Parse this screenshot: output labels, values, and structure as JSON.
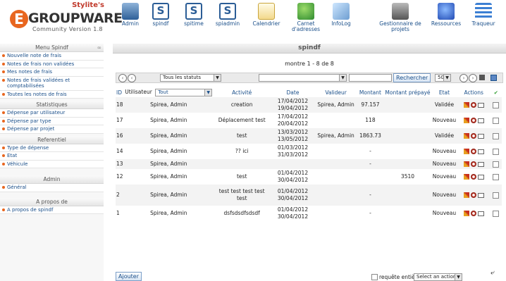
{
  "logo": {
    "brand": "Stylite's",
    "letter": "E",
    "name": "GROUPWARE",
    "version": "Community Version 1.8"
  },
  "apps": [
    {
      "label": "Admin",
      "icon": "admin-icon"
    },
    {
      "label": "spindf",
      "icon": "spindf-icon"
    },
    {
      "label": "spitime",
      "icon": "spitime-icon"
    },
    {
      "label": "spiadmin",
      "icon": "spiadmin-icon"
    },
    {
      "label": "Calendrier",
      "icon": "calendar-icon"
    },
    {
      "label": "Carnet d'adresses",
      "icon": "addressbook-icon"
    },
    {
      "label": "InfoLog",
      "icon": "infolog-icon"
    },
    {
      "label": "Gestionnaire de projets",
      "icon": "projects-icon"
    },
    {
      "label": "Ressources",
      "icon": "resources-icon"
    },
    {
      "label": "Traqueur",
      "icon": "tracker-icon"
    }
  ],
  "sidebar": {
    "menu_title": "Menu Spindf",
    "menu_items": [
      "Nouvelle note de frais",
      "Notes de frais non validées",
      "Mes notes de frais",
      "Notes de frais validées et comptabilisées",
      "Toutes les notes de frais"
    ],
    "stats_title": "Statistiques",
    "stats_items": [
      "Dépense par utilisateur",
      "Dépense par type",
      "Dépense par projet"
    ],
    "ref_title": "Referentiel",
    "ref_items": [
      "Type de dépense",
      "Etat",
      "Véhicule"
    ],
    "admin_title": "Admin",
    "admin_items": [
      "Général"
    ],
    "about_title": "A propos de",
    "about_items": [
      "A propos de spindf"
    ]
  },
  "main": {
    "title": "spindf",
    "showing": "montre 1 - 8 de 8",
    "filter": {
      "status": "Tous les statuts",
      "search_button": "Rechercher",
      "page_size": "50"
    },
    "columns": {
      "id": "ID",
      "user": "Utilisateur",
      "user_filter": "Tout",
      "activity": "Activité",
      "date": "Date",
      "validator": "Valideur",
      "amount": "Montant",
      "prepaid": "Montant prépayé",
      "state": "Etat",
      "actions": "Actions"
    },
    "rows": [
      {
        "id": "18",
        "user": "Spirea, Admin",
        "activity": "creation",
        "date1": "17/04/2012",
        "date2": "19/04/2012",
        "validator": "Spirea, Admin",
        "amount": "97.157",
        "prepaid": "",
        "state": "Validée"
      },
      {
        "id": "17",
        "user": "Spirea, Admin",
        "activity": "Déplacement test",
        "date1": "17/04/2012",
        "date2": "20/04/2012",
        "validator": "",
        "amount": "118",
        "prepaid": "",
        "state": "Nouveau"
      },
      {
        "id": "16",
        "user": "Spirea, Admin",
        "activity": "test",
        "date1": "13/03/2012",
        "date2": "13/05/2012",
        "validator": "Spirea, Admin",
        "amount": "1863.73",
        "prepaid": "",
        "state": "Validée"
      },
      {
        "id": "14",
        "user": "Spirea, Admin",
        "activity": "?? ici",
        "date1": "01/03/2012",
        "date2": "31/03/2012",
        "validator": "",
        "amount": "-",
        "prepaid": "",
        "state": "Nouveau"
      },
      {
        "id": "13",
        "user": "Spirea, Admin",
        "activity": "",
        "date1": "",
        "date2": "",
        "validator": "",
        "amount": "-",
        "prepaid": "",
        "state": "Nouveau"
      },
      {
        "id": "12",
        "user": "Spirea, Admin",
        "activity": "test",
        "date1": "01/04/2012",
        "date2": "30/04/2012",
        "validator": "",
        "amount": "",
        "prepaid": "3510",
        "state": "Nouveau"
      },
      {
        "id": "2",
        "user": "Spirea, Admin",
        "activity": "test test test test test",
        "date1": "01/04/2012",
        "date2": "30/04/2012",
        "validator": "",
        "amount": "-",
        "prepaid": "",
        "state": "Nouveau"
      },
      {
        "id": "1",
        "user": "Spirea, Admin",
        "activity": "dsfsdsdfsdsdf",
        "date1": "01/04/2012",
        "date2": "30/04/2012",
        "validator": "",
        "amount": "-",
        "prepaid": "",
        "state": "Nouveau"
      }
    ],
    "add_button": "Ajouter",
    "whole_query": "requête entière",
    "action_select": "Select an action..."
  }
}
